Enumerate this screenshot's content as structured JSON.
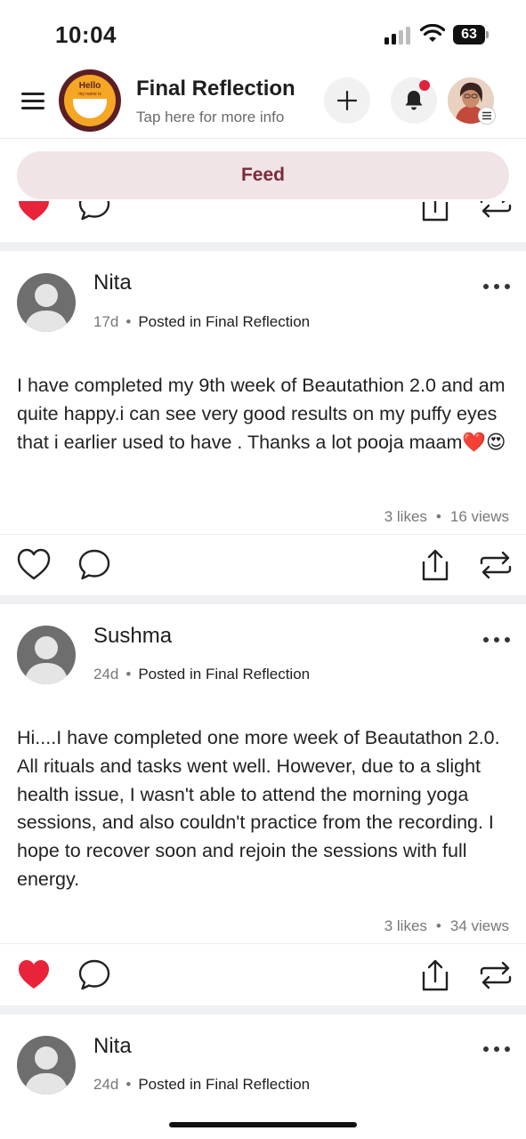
{
  "status_bar": {
    "time": "10:04",
    "battery": "63",
    "icons": [
      "cellular-signal-icon",
      "wifi-icon",
      "battery-icon"
    ]
  },
  "header": {
    "title": "Final Reflection",
    "subtitle": "Tap here for more info",
    "logo_text": "Hello",
    "logo_subtext": "my name is",
    "icons": [
      "menu-icon",
      "plus-icon",
      "bell-icon",
      "profile-avatar"
    ],
    "notification_dot_color": "#e0233a"
  },
  "tabs": {
    "active": "Feed"
  },
  "posts": [
    {
      "author": "Nita",
      "age": "17d",
      "posted_in_prefix": "Posted in ",
      "space": "Final Reflection",
      "body": "I have completed my 9th week of Beautathion 2.0 and am quite happy.i can see very good results on my puffy eyes that i earlier used to have . Thanks a lot pooja maam❤️😍",
      "likes": "3 likes",
      "views": "16 views",
      "liked": false
    },
    {
      "author": "Sushma",
      "age": "24d",
      "posted_in_prefix": "Posted in ",
      "space": "Final Reflection",
      "body": "Hi....I have completed one more week of Beautathon 2.0. All rituals and tasks went well. However, due to a slight health issue, I wasn't able to attend the morning yoga sessions, and also couldn't practice from the recording. I hope to recover soon and rejoin the sessions with full energy.",
      "likes": "3 likes",
      "views": "34 views",
      "liked": true
    },
    {
      "author": "Nita",
      "age": "24d",
      "posted_in_prefix": "Posted in ",
      "space": "Final Reflection"
    }
  ],
  "colors": {
    "accent": "#7a2b3a",
    "tab_bg": "#f1e4e7",
    "like_red": "#e8233a"
  }
}
